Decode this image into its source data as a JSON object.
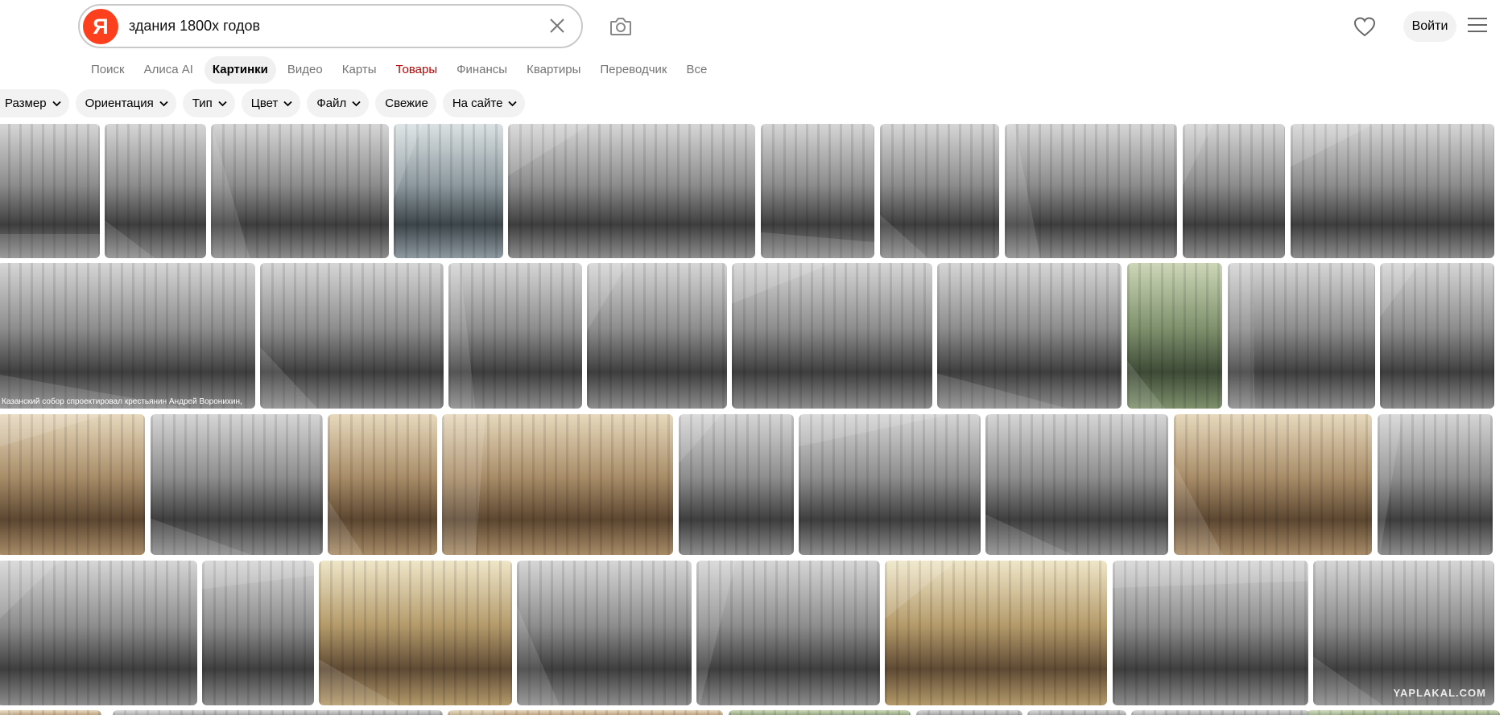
{
  "search": {
    "logo": "Я",
    "query": "здания 1800х годов"
  },
  "header": {
    "login_label": "Войти"
  },
  "tabs": [
    {
      "label": "Поиск"
    },
    {
      "label": "Алиса AI"
    },
    {
      "label": "Картинки"
    },
    {
      "label": "Видео"
    },
    {
      "label": "Карты"
    },
    {
      "label": "Товары"
    },
    {
      "label": "Финансы"
    },
    {
      "label": "Квартиры"
    },
    {
      "label": "Переводчик"
    },
    {
      "label": "Все"
    }
  ],
  "active_tab": "Картинки",
  "filters": [
    {
      "label": "Размер",
      "dropdown": true
    },
    {
      "label": "Ориентация",
      "dropdown": true
    },
    {
      "label": "Тип",
      "dropdown": true
    },
    {
      "label": "Цвет",
      "dropdown": true
    },
    {
      "label": "Файл",
      "dropdown": true
    },
    {
      "label": "Свежие",
      "dropdown": false
    },
    {
      "label": "На сайте",
      "dropdown": true
    }
  ],
  "images": {
    "caption_kazan": "Казанский собор спроектировал крестьянин Андрей Воронихин,",
    "watermark_yaplakal": "YAPLAKAL.COM"
  },
  "colors": {
    "brand_red": "#fc3f1d",
    "tab_red": "#c00000",
    "pill_bg": "#f2f2f2"
  },
  "icons": [
    "yandex-logo",
    "close-icon",
    "camera-icon",
    "heart-icon",
    "menu-icon",
    "chevron-down-icon"
  ]
}
